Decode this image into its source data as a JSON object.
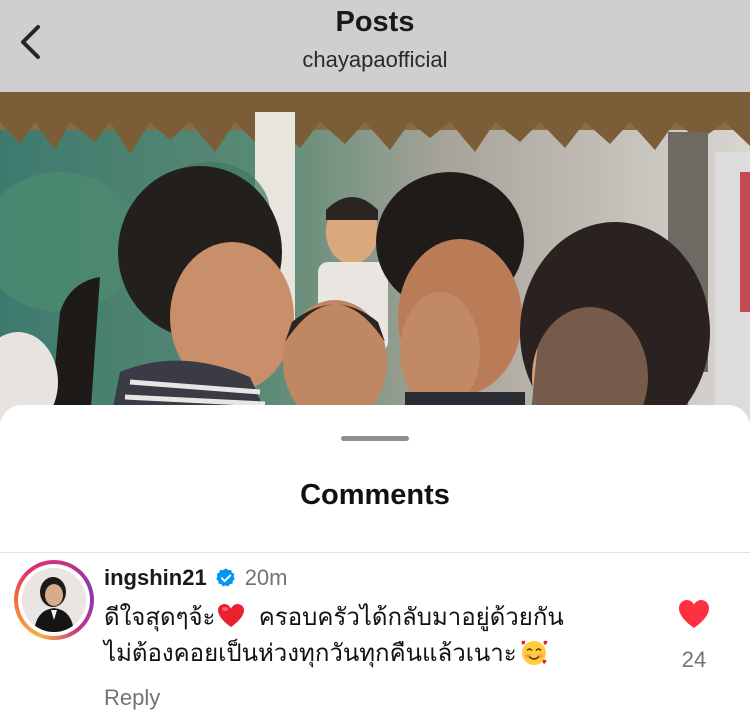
{
  "header": {
    "title": "Posts",
    "subtitle": "chayapaofficial",
    "back_icon": "chevron-left-icon"
  },
  "photo": {
    "description_icon": "post-photo"
  },
  "comments_sheet": {
    "title": "Comments",
    "comment": {
      "username": "ingshin21",
      "verified_icon": "verified-badge-icon",
      "time": "20m",
      "line1": "ดีใจสุดๆจ้ะ",
      "line1_rest": "ครอบครัวได้กลับมาอยู่ด้วยกัน",
      "line2": "ไม่ต้องคอยเป็นห่วงทุกวันทุกคืนแล้วเนาะ",
      "reply_label": "Reply",
      "like_count": "24",
      "like_icon": "heart-filled-icon",
      "heart_color": "#ff3040"
    }
  },
  "colors": {
    "header_bg": "#cfcfcf",
    "muted_text": "#737373",
    "verified_blue": "#0095f6"
  }
}
